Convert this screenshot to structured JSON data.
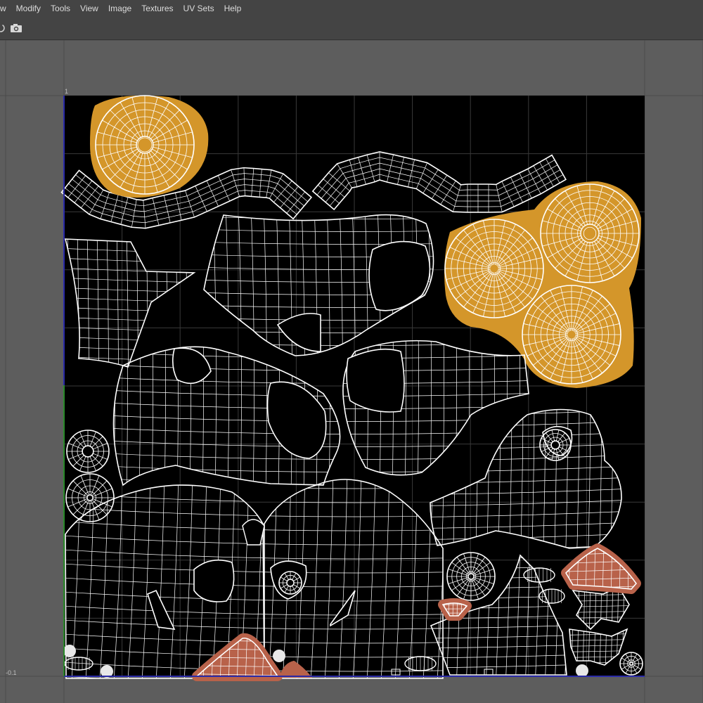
{
  "menu": {
    "items": [
      {
        "label": "w"
      },
      {
        "label": "Modify"
      },
      {
        "label": "Tools"
      },
      {
        "label": "View"
      },
      {
        "label": "Image"
      },
      {
        "label": "Textures"
      },
      {
        "label": "UV Sets"
      },
      {
        "label": "Help"
      }
    ]
  },
  "toolbar": {
    "icons": [
      "rotate-icon",
      "camera-icon"
    ]
  },
  "viewport": {
    "axis_top": "1",
    "axis_bottom": "-0.1",
    "colors": {
      "background": "#5d5d5d",
      "grid_line": "#4a4a4a",
      "texture_area": "#000000",
      "uv_wire": "#ffffff",
      "selected_orange": "#d4962a",
      "selected_red": "#b8624a",
      "u_axis": "#2a2aa8",
      "v_axis": "#2a8a2a"
    }
  }
}
